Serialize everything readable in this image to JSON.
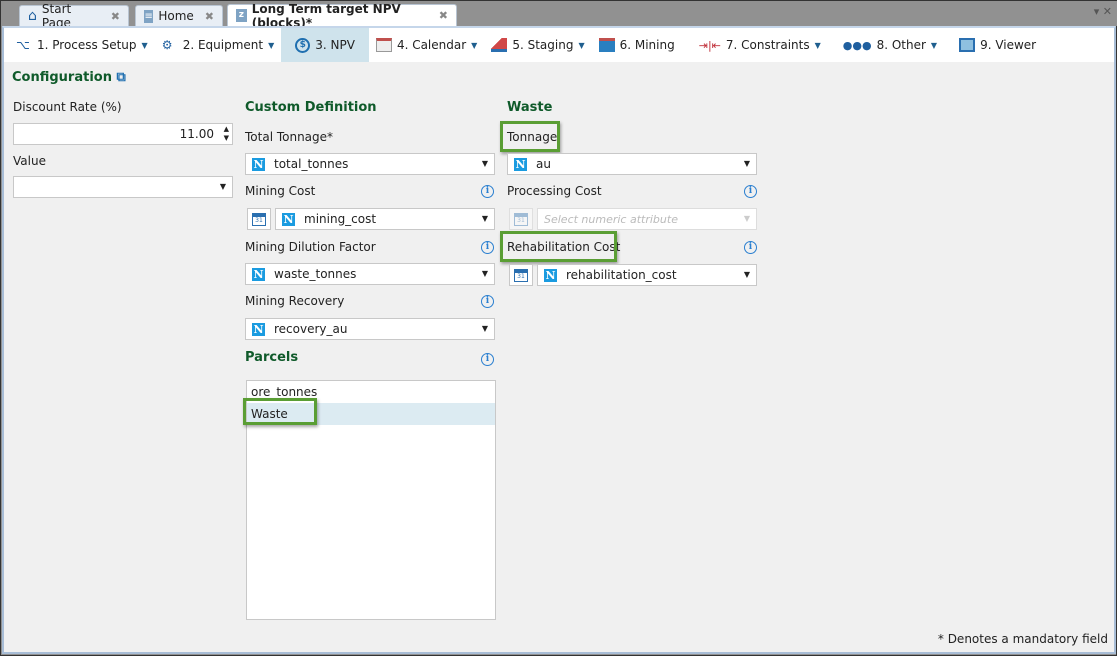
{
  "tabs": [
    {
      "label": "Start Page",
      "icon": "home-icon"
    },
    {
      "label": "Home",
      "icon": "document-icon"
    },
    {
      "label": "Long Term target NPV (blocks)*",
      "icon": "npv-icon",
      "active": true
    }
  ],
  "toolbar": [
    {
      "label": "1. Process Setup",
      "dropdown": true
    },
    {
      "label": "2. Equipment",
      "dropdown": true
    },
    {
      "label": "3. NPV",
      "dropdown": false,
      "active": true
    },
    {
      "label": "4. Calendar",
      "dropdown": true
    },
    {
      "label": "5. Staging",
      "dropdown": true
    },
    {
      "label": "6. Mining",
      "dropdown": false
    },
    {
      "label": "7. Constraints",
      "dropdown": true
    },
    {
      "label": "8. Other",
      "dropdown": true
    },
    {
      "label": "9. Viewer",
      "dropdown": false
    }
  ],
  "config": {
    "title": "Configuration",
    "discount_label": "Discount Rate (%)",
    "discount_value": "11.00",
    "value_label": "Value",
    "value_selected": ""
  },
  "custom": {
    "title": "Custom Definition",
    "total_tonnage_label": "Total Tonnage*",
    "total_tonnage": "total_tonnes",
    "mining_cost_label": "Mining Cost",
    "mining_cost": "mining_cost",
    "dilution_label": "Mining Dilution Factor",
    "dilution": "waste_tonnes",
    "recovery_label": "Mining Recovery",
    "recovery": "recovery_au"
  },
  "parcels": {
    "title": "Parcels",
    "items": [
      "ore_tonnes",
      "Waste"
    ],
    "selected": 1
  },
  "waste": {
    "title": "Waste",
    "tonnage_label": "Tonnage",
    "tonnage": "au",
    "processing_label": "Processing Cost",
    "processing_placeholder": "Select numeric attribute",
    "rehab_label": "Rehabilitation Cost",
    "rehab": "rehabilitation_cost"
  },
  "footer": "* Denotes a mandatory field",
  "colors": {
    "accent": "#0f5a2a",
    "highlight": "#5a9e34",
    "selected": "#cfe3ec"
  }
}
